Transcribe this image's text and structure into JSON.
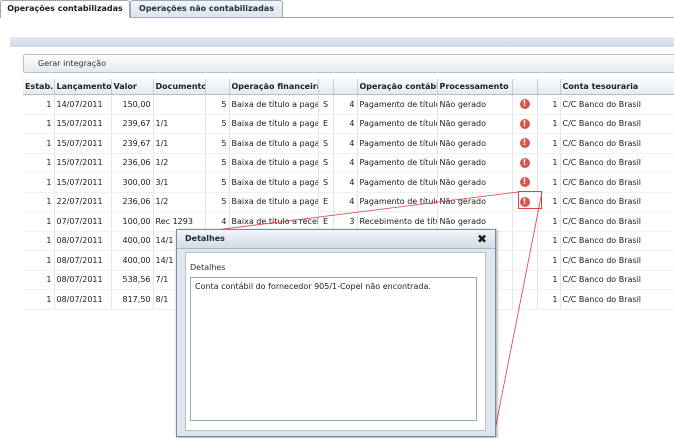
{
  "tabs": [
    {
      "label": "Operações contabilizadas"
    },
    {
      "label": "Operações não contabilizadas"
    }
  ],
  "toolbar": {
    "generate_label": "Gerar integração"
  },
  "columns": [
    "Estab.",
    "Lançamento",
    "Valor",
    "Documento",
    "",
    "Operação financeira",
    "",
    "",
    "Operação contábil",
    "Processamento",
    "",
    "",
    "Conta tesouraria"
  ],
  "rows": [
    {
      "estab": "1",
      "lancamento": "14/07/2011",
      "valor": "150,00",
      "documento": "",
      "num": "5",
      "op_fin": "Baixa de título a pagar",
      "tipo": "S",
      "num2": "4",
      "op_cont": "Pagamento de títulos",
      "proc": "Não gerado",
      "status": "error",
      "conta_num": "1",
      "conta": "C/C Banco do Brasil"
    },
    {
      "estab": "1",
      "lancamento": "15/07/2011",
      "valor": "239,67",
      "documento": "1/1",
      "num": "5",
      "op_fin": "Baixa de título a pagar",
      "tipo": "E",
      "num2": "4",
      "op_cont": "Pagamento de títulos",
      "proc": "Não gerado",
      "status": "error",
      "conta_num": "1",
      "conta": "C/C Banco do Brasil"
    },
    {
      "estab": "1",
      "lancamento": "15/07/2011",
      "valor": "239,67",
      "documento": "1/1",
      "num": "5",
      "op_fin": "Baixa de título a pagar",
      "tipo": "S",
      "num2": "4",
      "op_cont": "Pagamento de títulos",
      "proc": "Não gerado",
      "status": "error",
      "conta_num": "1",
      "conta": "C/C Banco do Brasil"
    },
    {
      "estab": "1",
      "lancamento": "15/07/2011",
      "valor": "236,06",
      "documento": "1/2",
      "num": "5",
      "op_fin": "Baixa de título a pagar",
      "tipo": "S",
      "num2": "4",
      "op_cont": "Pagamento de títulos",
      "proc": "Não gerado",
      "status": "error",
      "conta_num": "1",
      "conta": "C/C Banco do Brasil"
    },
    {
      "estab": "1",
      "lancamento": "15/07/2011",
      "valor": "300,00",
      "documento": "3/1",
      "num": "5",
      "op_fin": "Baixa de título a pagar",
      "tipo": "S",
      "num2": "4",
      "op_cont": "Pagamento de títulos",
      "proc": "Não gerado",
      "status": "error",
      "conta_num": "1",
      "conta": "C/C Banco do Brasil"
    },
    {
      "estab": "1",
      "lancamento": "22/07/2011",
      "valor": "236,06",
      "documento": "1/2",
      "num": "5",
      "op_fin": "Baixa de título a pagar",
      "tipo": "E",
      "num2": "4",
      "op_cont": "Pagamento de títulos",
      "proc": "Não gerado",
      "status": "error",
      "conta_num": "1",
      "conta": "C/C Banco do Brasil"
    },
    {
      "estab": "1",
      "lancamento": "07/07/2011",
      "valor": "100,00",
      "documento": "Rec 1293",
      "num": "4",
      "op_fin": "Baixa de título a receber",
      "tipo": "E",
      "num2": "3",
      "op_cont": "Recebimento de títulos",
      "proc": "Não gerado",
      "status": "",
      "conta_num": "1",
      "conta": "C/C Banco do Brasil"
    },
    {
      "estab": "1",
      "lancamento": "08/07/2011",
      "valor": "400,00",
      "documento": "14/1",
      "num": "",
      "op_fin": "",
      "tipo": "",
      "num2": "",
      "op_cont": "",
      "proc": "",
      "status": "",
      "conta_num": "1",
      "conta": "C/C Banco do Brasil"
    },
    {
      "estab": "1",
      "lancamento": "08/07/2011",
      "valor": "400,00",
      "documento": "14/1",
      "num": "",
      "op_fin": "",
      "tipo": "",
      "num2": "",
      "op_cont": "",
      "proc": "",
      "status": "",
      "conta_num": "1",
      "conta": "C/C Banco do Brasil"
    },
    {
      "estab": "1",
      "lancamento": "08/07/2011",
      "valor": "538,56",
      "documento": "7/1",
      "num": "",
      "op_fin": "",
      "tipo": "",
      "num2": "",
      "op_cont": "",
      "proc": "",
      "status": "",
      "conta_num": "1",
      "conta": "C/C Banco do Brasil"
    },
    {
      "estab": "1",
      "lancamento": "08/07/2011",
      "valor": "817,50",
      "documento": "8/1",
      "num": "",
      "op_fin": "",
      "tipo": "",
      "num2": "",
      "op_cont": "",
      "proc": "",
      "status": "",
      "conta_num": "1",
      "conta": "C/C Banco do Brasil"
    }
  ],
  "status_icon": {
    "error": "!"
  },
  "dialog": {
    "title": "Detalhes",
    "label": "Detalhes",
    "message": "Conta contábil do fornecedor 905/1-Copel não encontrada.",
    "close_icon": "✖"
  },
  "colors": {
    "error": "#d9534f",
    "callout": "#e04040"
  }
}
